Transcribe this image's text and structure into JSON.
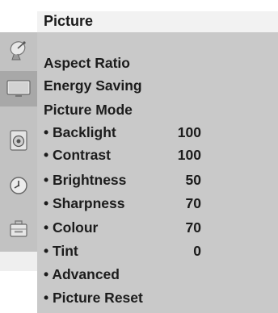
{
  "menu": {
    "title": "Picture",
    "items": [
      {
        "label": "Aspect Ratio",
        "value": ""
      },
      {
        "label": "Energy Saving",
        "value": ""
      },
      {
        "label": "Picture Mode",
        "value": ""
      },
      {
        "label": "• Backlight",
        "value": "100"
      },
      {
        "label": "• Contrast",
        "value": "100"
      },
      {
        "label": "• Brightness",
        "value": "50"
      },
      {
        "label": "• Sharpness",
        "value": "70"
      },
      {
        "label": "• Colour",
        "value": "70"
      },
      {
        "label": "• Tint",
        "value": "0"
      },
      {
        "label": "• Advanced",
        "value": ""
      },
      {
        "label": "• Picture Reset",
        "value": ""
      }
    ]
  },
  "sidebar": {
    "icons": [
      {
        "name": "satellite-dish-icon",
        "active": false
      },
      {
        "name": "tv-screen-icon",
        "active": true
      },
      {
        "name": "speaker-icon",
        "active": false
      },
      {
        "name": "clock-icon",
        "active": false
      },
      {
        "name": "toolbox-icon",
        "active": false
      }
    ]
  },
  "colors": {
    "panel": "#c9c9c9",
    "sidebar": "#c2c2c2",
    "active_icon_bg": "#a8a8a8",
    "title_bar": "#f2f2f2",
    "text": "#1c1c1c"
  }
}
